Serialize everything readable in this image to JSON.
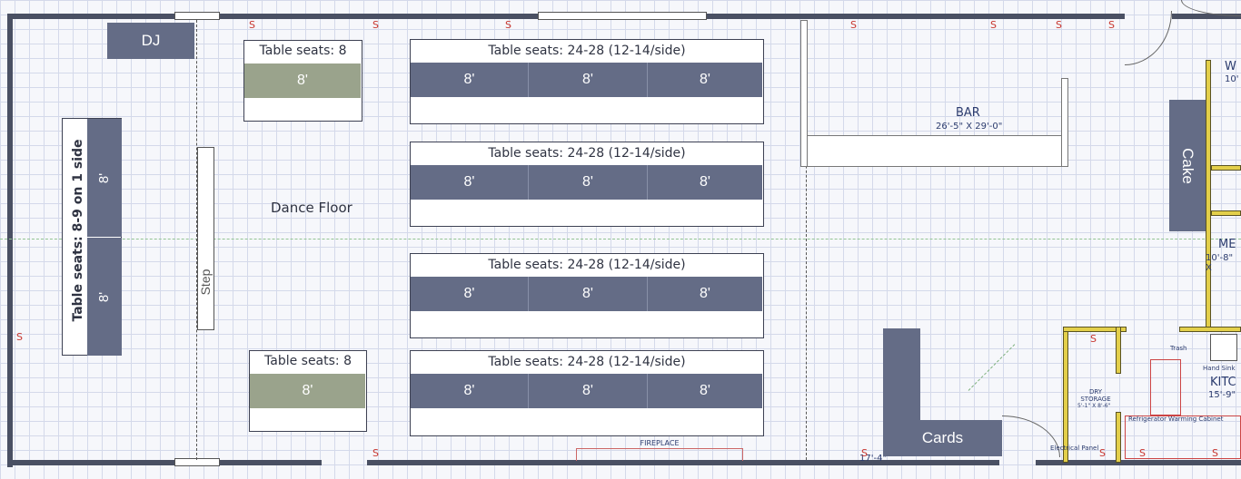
{
  "labels": {
    "dj": "DJ",
    "dance_floor": "Dance Floor",
    "step": "Step",
    "cake": "Cake",
    "cards": "Cards",
    "bar_title": "BAR",
    "bar_dims": "26'-5\" X 29'-0\"",
    "fireplace": "FIREPLACE",
    "dim_bottom": "17'-4\"",
    "dry_storage": "DRY STORAGE",
    "dry_storage_dims": "5'-1\" X 8'-6\"",
    "trash": "Trash",
    "hand_sink": "Hand Sink",
    "kitchen": "KITC",
    "kitchen_dims": "15'-9\"",
    "refrigerator": "Refrigerator",
    "warming_cabinet": "Warming Cabinet",
    "electrical_panel": "Electrical Panel",
    "room_w": "W",
    "room_w_dims": "10'",
    "room_me": "ME",
    "room_me_dims": "10'-8\" X",
    "marker_s": "S"
  },
  "long_table": {
    "label": "Table seats: 8-9 on 1 side",
    "segments": [
      "8'",
      "8'"
    ]
  },
  "small_tables": [
    {
      "label": "Table seats: 8",
      "segment": "8'"
    },
    {
      "label": "Table seats: 8",
      "segment": "8'"
    }
  ],
  "banquet_tables": [
    {
      "label": "Table seats: 24-28 (12-14/side)",
      "segments": [
        "8'",
        "8'",
        "8'"
      ]
    },
    {
      "label": "Table seats: 24-28 (12-14/side)",
      "segments": [
        "8'",
        "8'",
        "8'"
      ]
    },
    {
      "label": "Table seats: 24-28 (12-14/side)",
      "segments": [
        "8'",
        "8'",
        "8'"
      ]
    },
    {
      "label": "Table seats: 24-28 (12-14/side)",
      "segments": [
        "8'",
        "8'",
        "8'"
      ]
    }
  ],
  "colors": {
    "table_slate": "#646c86",
    "table_olive": "#9aa38c",
    "wall": "#4a5063",
    "outlet_marker": "#c8362f",
    "kitchen_wall": "#e3cf4a"
  }
}
